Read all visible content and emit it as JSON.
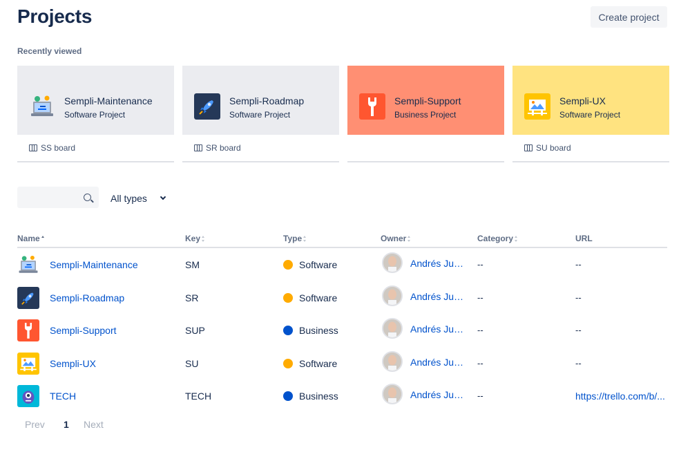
{
  "header": {
    "title": "Projects",
    "create_label": "Create project"
  },
  "recent": {
    "label": "Recently viewed",
    "cards": [
      {
        "title": "Sempli-Maintenance",
        "subtitle": "Software Project",
        "board": "SS board",
        "bg": "#ebecf0",
        "icon": "maintenance-avatar-icon"
      },
      {
        "title": "Sempli-Roadmap",
        "subtitle": "Software Project",
        "board": "SR board",
        "bg": "#ebecf0",
        "icon": "rocket-avatar-icon"
      },
      {
        "title": "Sempli-Support",
        "subtitle": "Business Project",
        "board": "",
        "bg": "#ff8f73",
        "icon": "wrench-avatar-icon"
      },
      {
        "title": "Sempli-UX",
        "subtitle": "Software Project",
        "board": "SU board",
        "bg": "#ffe380",
        "icon": "ux-avatar-icon"
      }
    ]
  },
  "filters": {
    "search_placeholder": "",
    "type_label": "All types"
  },
  "table": {
    "columns": [
      "Name",
      "Key",
      "Type",
      "Owner",
      "Category",
      "URL"
    ],
    "rows": [
      {
        "name": "Sempli-Maintenance",
        "key": "SM",
        "type": "Software",
        "owner": "Andrés Julián",
        "category": "--",
        "url": "--",
        "icon": "maintenance-avatar-icon"
      },
      {
        "name": "Sempli-Roadmap",
        "key": "SR",
        "type": "Software",
        "owner": "Andrés Julián",
        "category": "--",
        "url": "--",
        "icon": "rocket-avatar-icon"
      },
      {
        "name": "Sempli-Support",
        "key": "SUP",
        "type": "Business",
        "owner": "Andrés Julián",
        "category": "--",
        "url": "--",
        "icon": "wrench-avatar-icon"
      },
      {
        "name": "Sempli-UX",
        "key": "SU",
        "type": "Software",
        "owner": "Andrés Julián",
        "category": "--",
        "url": "--",
        "icon": "ux-avatar-icon"
      },
      {
        "name": "TECH",
        "key": "TECH",
        "type": "Business",
        "owner": "Andrés Julián",
        "category": "--",
        "url": "https://trello.com/b/...",
        "icon": "monster-avatar-icon"
      }
    ]
  },
  "pagination": {
    "prev": "Prev",
    "current": "1",
    "next": "Next"
  },
  "colors": {
    "software": "#ffab00",
    "business": "#0052cc",
    "link": "#0052cc"
  }
}
